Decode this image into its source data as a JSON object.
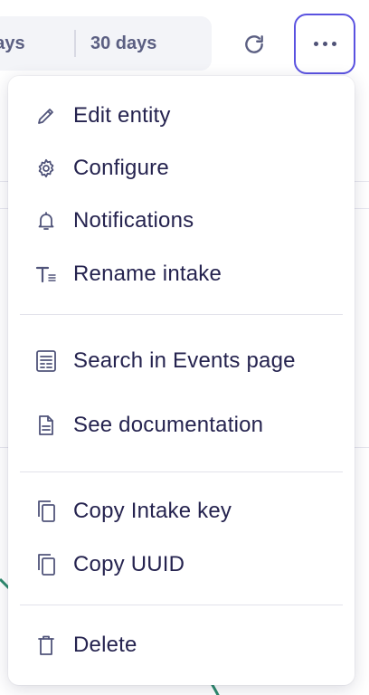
{
  "toolbar": {
    "range_partial": "days",
    "range_30": "30 days",
    "refresh_icon": "refresh-icon",
    "more_icon": "more-horizontal-icon",
    "accent": "#5a52e0"
  },
  "menu": {
    "items": [
      {
        "label": "Edit entity",
        "icon": "pencil-icon"
      },
      {
        "label": "Configure",
        "icon": "gear-icon"
      },
      {
        "label": "Notifications",
        "icon": "bell-icon"
      },
      {
        "label": "Rename intake",
        "icon": "text-rename-icon"
      },
      {
        "label": "Search in Events page",
        "icon": "events-list-icon"
      },
      {
        "label": "See documentation",
        "icon": "document-icon"
      },
      {
        "label": "Copy Intake key",
        "icon": "copy-icon"
      },
      {
        "label": "Copy UUID",
        "icon": "copy-icon"
      },
      {
        "label": "Delete",
        "icon": "trash-icon"
      }
    ]
  }
}
